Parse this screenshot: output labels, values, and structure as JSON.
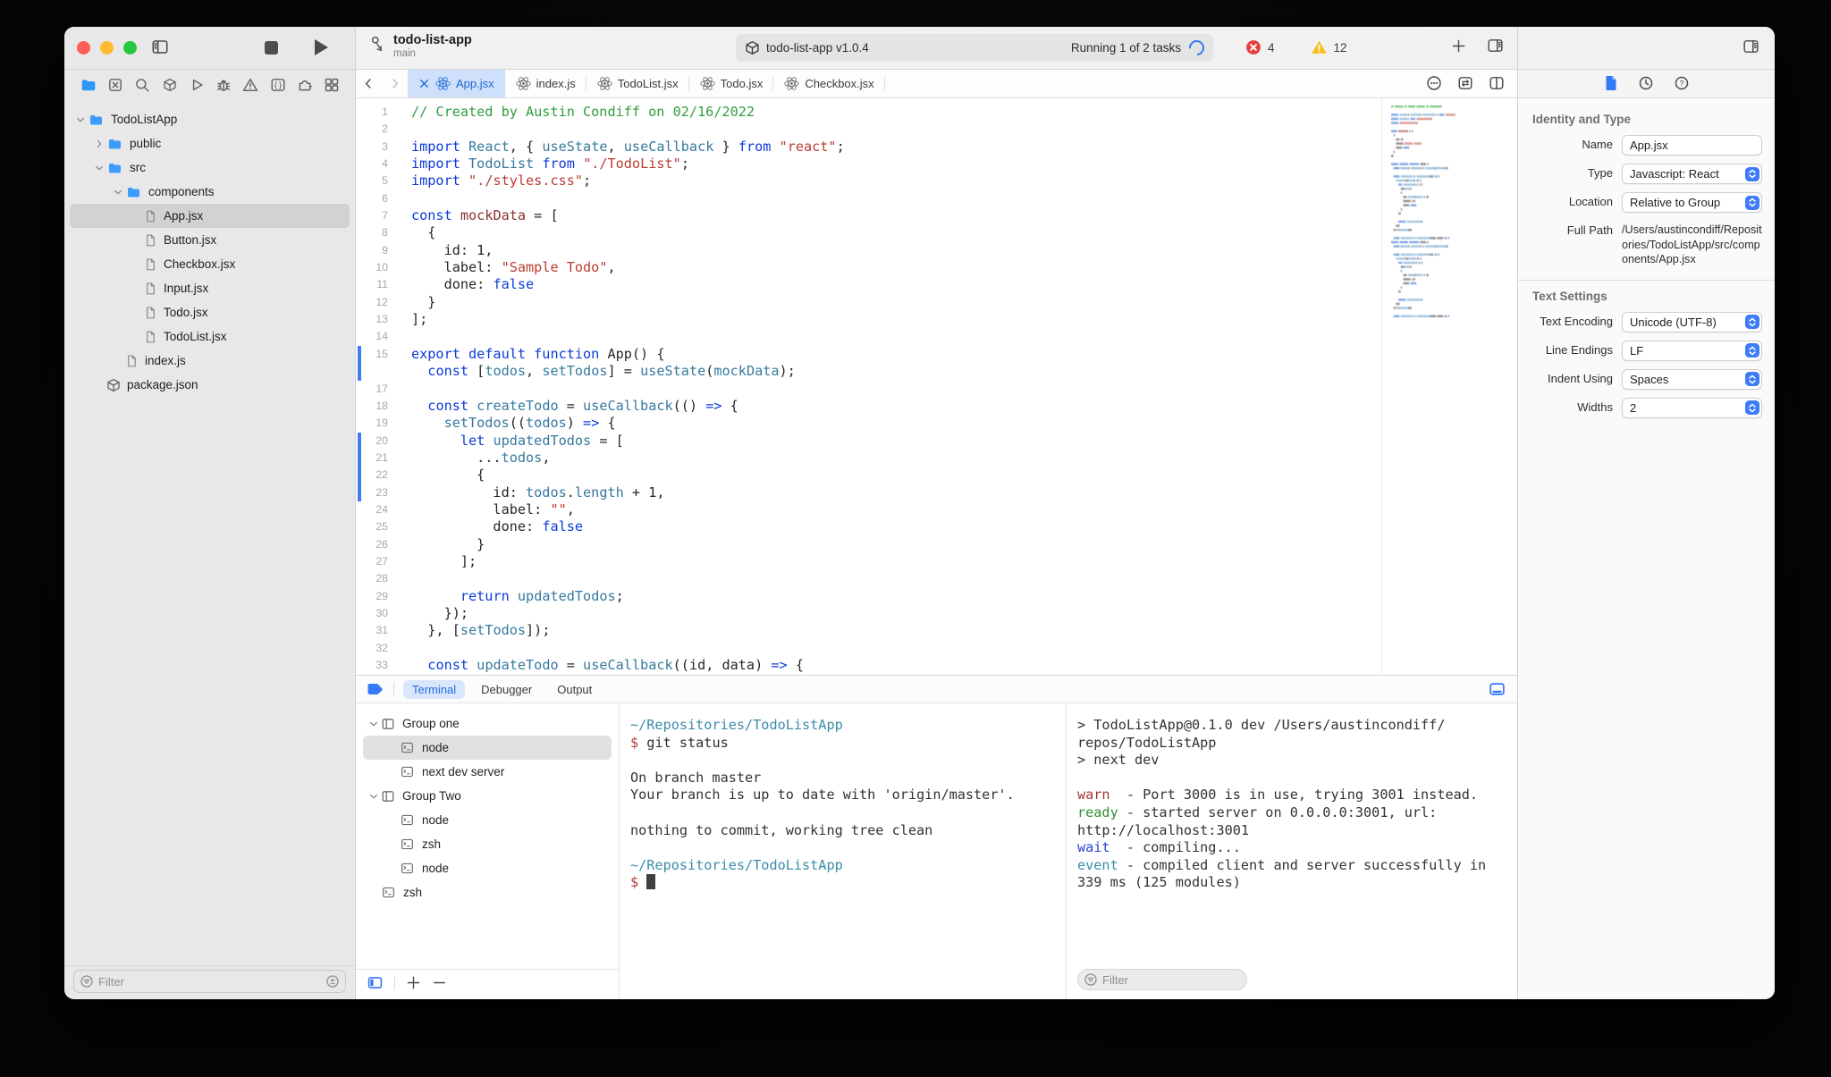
{
  "window": {
    "title": "todo-list-app",
    "branch": "main"
  },
  "toolbar": {
    "status_package": "todo-list-app v1.0.4",
    "status_running": "Running 1 of 2 tasks",
    "error_count": "4",
    "warning_count": "12"
  },
  "navigator": {
    "icons": [
      "project-folder",
      "changes",
      "search",
      "package",
      "run",
      "bug",
      "issues",
      "symbols",
      "extensions",
      "overview"
    ],
    "active_icon_index": 0,
    "filter_placeholder": "Filter",
    "tree": [
      {
        "depth": 0,
        "chev": "down",
        "icon": "folder",
        "label": "TodoListApp"
      },
      {
        "depth": 1,
        "chev": "right",
        "icon": "folder",
        "label": "public"
      },
      {
        "depth": 1,
        "chev": "down",
        "icon": "folder",
        "label": "src"
      },
      {
        "depth": 2,
        "chev": "down",
        "icon": "folder",
        "label": "components"
      },
      {
        "depth": 3,
        "chev": "none",
        "icon": "file",
        "label": "App.jsx",
        "selected": true
      },
      {
        "depth": 3,
        "chev": "none",
        "icon": "file",
        "label": "Button.jsx"
      },
      {
        "depth": 3,
        "chev": "none",
        "icon": "file",
        "label": "Checkbox.jsx"
      },
      {
        "depth": 3,
        "chev": "none",
        "icon": "file",
        "label": "Input.jsx"
      },
      {
        "depth": 3,
        "chev": "none",
        "icon": "file",
        "label": "Todo.jsx"
      },
      {
        "depth": 3,
        "chev": "none",
        "icon": "file",
        "label": "TodoList.jsx"
      },
      {
        "depth": 2,
        "chev": "none",
        "icon": "file",
        "label": "index.js"
      },
      {
        "depth": 1,
        "chev": "none",
        "icon": "package",
        "label": "package.json"
      }
    ]
  },
  "tabs": [
    {
      "label": "App.jsx",
      "active": true
    },
    {
      "label": "index.js"
    },
    {
      "label": "TodoList.jsx"
    },
    {
      "label": "Todo.jsx"
    },
    {
      "label": "Checkbox.jsx"
    }
  ],
  "editor": {
    "lines": [
      {
        "n": "1",
        "spans": [
          [
            "// Created by Austin Condiff on 02/16/2022",
            "c"
          ]
        ]
      },
      {
        "n": "2",
        "spans": []
      },
      {
        "n": "3",
        "spans": [
          [
            "import",
            "k"
          ],
          [
            " ",
            "p"
          ],
          [
            "React",
            "t"
          ],
          [
            ", { ",
            "p"
          ],
          [
            "useState",
            "t"
          ],
          [
            ", ",
            "p"
          ],
          [
            "useCallback",
            "t"
          ],
          [
            " } ",
            "p"
          ],
          [
            "from",
            "k"
          ],
          [
            " ",
            "p"
          ],
          [
            "\"react\"",
            "s"
          ],
          [
            ";",
            "p"
          ]
        ]
      },
      {
        "n": "4",
        "spans": [
          [
            "import",
            "k"
          ],
          [
            " ",
            "p"
          ],
          [
            "TodoList",
            "t"
          ],
          [
            " ",
            "p"
          ],
          [
            "from",
            "k"
          ],
          [
            " ",
            "p"
          ],
          [
            "\"./TodoList\"",
            "s"
          ],
          [
            ";",
            "p"
          ]
        ]
      },
      {
        "n": "5",
        "spans": [
          [
            "import",
            "k"
          ],
          [
            " ",
            "p"
          ],
          [
            "\"./styles.css\"",
            "s"
          ],
          [
            ";",
            "p"
          ]
        ]
      },
      {
        "n": "6",
        "spans": []
      },
      {
        "n": "7",
        "spans": [
          [
            "const",
            "k"
          ],
          [
            " ",
            "p"
          ],
          [
            "mockData",
            "d"
          ],
          [
            " = [",
            "p"
          ]
        ]
      },
      {
        "n": "8",
        "spans": [
          [
            "  {",
            "p"
          ]
        ]
      },
      {
        "n": "9",
        "spans": [
          [
            "    id: 1,",
            "p"
          ]
        ]
      },
      {
        "n": "10",
        "spans": [
          [
            "    label: ",
            "p"
          ],
          [
            "\"Sample Todo\"",
            "s"
          ],
          [
            ",",
            "p"
          ]
        ]
      },
      {
        "n": "11",
        "spans": [
          [
            "    done: ",
            "p"
          ],
          [
            "false",
            "k"
          ]
        ]
      },
      {
        "n": "12",
        "spans": [
          [
            "  }",
            "p"
          ]
        ]
      },
      {
        "n": "13",
        "spans": [
          [
            "];",
            "p"
          ]
        ]
      },
      {
        "n": "14",
        "spans": []
      },
      {
        "n": "15",
        "changed": true,
        "spans": [
          [
            "export default function",
            "k"
          ],
          [
            " App() {",
            "p"
          ]
        ]
      },
      {
        "n": "",
        "changed": true,
        "spans": [
          [
            "  ",
            "p"
          ],
          [
            "const",
            "k"
          ],
          [
            " [",
            "p"
          ],
          [
            "todos",
            "t"
          ],
          [
            ", ",
            "p"
          ],
          [
            "setTodos",
            "t"
          ],
          [
            "] = ",
            "p"
          ],
          [
            "useState",
            "t"
          ],
          [
            "(",
            "p"
          ],
          [
            "mockData",
            "t"
          ],
          [
            ");",
            "p"
          ]
        ]
      },
      {
        "n": "17",
        "spans": []
      },
      {
        "n": "18",
        "spans": [
          [
            "  ",
            "p"
          ],
          [
            "const",
            "k"
          ],
          [
            " ",
            "p"
          ],
          [
            "createTodo",
            "t"
          ],
          [
            " = ",
            "p"
          ],
          [
            "useCallback",
            "t"
          ],
          [
            "(() ",
            "p"
          ],
          [
            "=>",
            "k"
          ],
          [
            " {",
            "p"
          ]
        ]
      },
      {
        "n": "19",
        "spans": [
          [
            "    ",
            "p"
          ],
          [
            "setTodos",
            "t"
          ],
          [
            "((",
            "p"
          ],
          [
            "todos",
            "t"
          ],
          [
            ") ",
            "p"
          ],
          [
            "=>",
            "k"
          ],
          [
            " {",
            "p"
          ]
        ]
      },
      {
        "n": "20",
        "changed": true,
        "spans": [
          [
            "      ",
            "p"
          ],
          [
            "let",
            "k"
          ],
          [
            " ",
            "p"
          ],
          [
            "updatedTodos",
            "t"
          ],
          [
            " = [",
            "p"
          ]
        ]
      },
      {
        "n": "21",
        "changed": true,
        "spans": [
          [
            "        ...",
            "p"
          ],
          [
            "todos",
            "t"
          ],
          [
            ",",
            "p"
          ]
        ]
      },
      {
        "n": "22",
        "changed": true,
        "spans": [
          [
            "        {",
            "p"
          ]
        ]
      },
      {
        "n": "23",
        "changed": true,
        "spans": [
          [
            "          id: ",
            "p"
          ],
          [
            "todos",
            "t"
          ],
          [
            ".",
            "p"
          ],
          [
            "length",
            "t"
          ],
          [
            " + 1,",
            "p"
          ]
        ]
      },
      {
        "n": "24",
        "spans": [
          [
            "          label: ",
            "p"
          ],
          [
            "\"\"",
            "s"
          ],
          [
            ",",
            "p"
          ]
        ]
      },
      {
        "n": "25",
        "spans": [
          [
            "          done: ",
            "p"
          ],
          [
            "false",
            "k"
          ]
        ]
      },
      {
        "n": "26",
        "spans": [
          [
            "        }",
            "p"
          ]
        ]
      },
      {
        "n": "27",
        "spans": [
          [
            "      ];",
            "p"
          ]
        ]
      },
      {
        "n": "28",
        "spans": []
      },
      {
        "n": "29",
        "spans": [
          [
            "      ",
            "p"
          ],
          [
            "return",
            "k"
          ],
          [
            " ",
            "p"
          ],
          [
            "updatedTodos",
            "t"
          ],
          [
            ";",
            "p"
          ]
        ]
      },
      {
        "n": "30",
        "spans": [
          [
            "    });",
            "p"
          ]
        ]
      },
      {
        "n": "31",
        "spans": [
          [
            "  }, [",
            "p"
          ],
          [
            "setTodos",
            "t"
          ],
          [
            "]);",
            "p"
          ]
        ]
      },
      {
        "n": "32",
        "spans": []
      },
      {
        "n": "33",
        "spans": [
          [
            "  ",
            "p"
          ],
          [
            "const",
            "k"
          ],
          [
            " ",
            "p"
          ],
          [
            "updateTodo",
            "t"
          ],
          [
            " = ",
            "p"
          ],
          [
            "useCallback",
            "t"
          ],
          [
            "((id, data) ",
            "p"
          ],
          [
            "=>",
            "k"
          ],
          [
            " {",
            "p"
          ]
        ]
      }
    ]
  },
  "terminal": {
    "tabs": [
      {
        "label": "Terminal",
        "active": true
      },
      {
        "label": "Debugger"
      },
      {
        "label": "Output"
      }
    ],
    "sessions": [
      {
        "depth": 0,
        "chev": "down",
        "icon": "group",
        "label": "Group one"
      },
      {
        "depth": 1,
        "chev": "none",
        "icon": "term",
        "label": "node",
        "selected": true
      },
      {
        "depth": 1,
        "chev": "none",
        "icon": "term",
        "label": "next dev server"
      },
      {
        "depth": 0,
        "chev": "down",
        "icon": "group",
        "label": "Group Two"
      },
      {
        "depth": 1,
        "chev": "none",
        "icon": "term",
        "label": "node"
      },
      {
        "depth": 1,
        "chev": "none",
        "icon": "term",
        "label": "zsh"
      },
      {
        "depth": 1,
        "chev": "none",
        "icon": "term",
        "label": "node"
      },
      {
        "depth": 0,
        "chev": "none",
        "icon": "term",
        "label": "zsh"
      }
    ],
    "main_output": [
      [
        [
          "~/Repositories/TodoListApp",
          "path"
        ]
      ],
      [
        [
          "$",
          "prompt"
        ],
        [
          " git status",
          "cmd"
        ]
      ],
      [],
      [
        [
          "On branch master",
          "out"
        ]
      ],
      [
        [
          "Your branch is up to date with 'origin/master'.",
          "out"
        ]
      ],
      [],
      [
        [
          "nothing to commit, working tree clean",
          "out"
        ]
      ],
      [],
      [
        [
          "~/Repositories/TodoListApp",
          "path"
        ]
      ],
      [
        [
          "$ ",
          "prompt"
        ],
        [
          "",
          "cursor"
        ]
      ]
    ],
    "right_output": [
      [
        [
          "> TodoListApp@0.1.0 dev /Users/austincondiff/",
          "out"
        ]
      ],
      [
        [
          "repos/TodoListApp",
          "out"
        ]
      ],
      [
        [
          "> next dev",
          "out"
        ]
      ],
      [],
      [
        [
          "warn",
          "warn"
        ],
        [
          "  - Port 3000 is in use, trying 3001 instead.",
          "out"
        ]
      ],
      [
        [
          "ready",
          "ready"
        ],
        [
          " - started server on 0.0.0.0:3001, url:",
          "out"
        ]
      ],
      [
        [
          "http://localhost:3001",
          "out"
        ]
      ],
      [
        [
          "wait",
          "wait"
        ],
        [
          "  - compiling...",
          "out"
        ]
      ],
      [
        [
          "event",
          "event"
        ],
        [
          " - compiled client and server successfully in",
          "out"
        ]
      ],
      [
        [
          "339 ms (125 modules)",
          "out"
        ]
      ]
    ],
    "filter_placeholder": "Filter"
  },
  "inspector": {
    "identity": {
      "header": "Identity and Type",
      "rows": [
        {
          "label": "Name",
          "value": "App.jsx",
          "control": "input"
        },
        {
          "label": "Type",
          "value": "Javascript: React",
          "control": "select"
        },
        {
          "label": "Location",
          "value": "Relative to Group",
          "control": "select"
        },
        {
          "label": "Full Path",
          "value": "/Users/austincondiff/Repositories/TodoListApp/src/components/App.jsx",
          "control": "text"
        }
      ]
    },
    "text_settings": {
      "header": "Text Settings",
      "rows": [
        {
          "label": "Text Encoding",
          "value": "Unicode (UTF-8)",
          "control": "select"
        },
        {
          "label": "Line Endings",
          "value": "LF",
          "control": "select"
        },
        {
          "label": "Indent Using",
          "value": "Spaces",
          "control": "select"
        },
        {
          "label": "Widths",
          "value": "2",
          "control": "select"
        }
      ]
    }
  }
}
